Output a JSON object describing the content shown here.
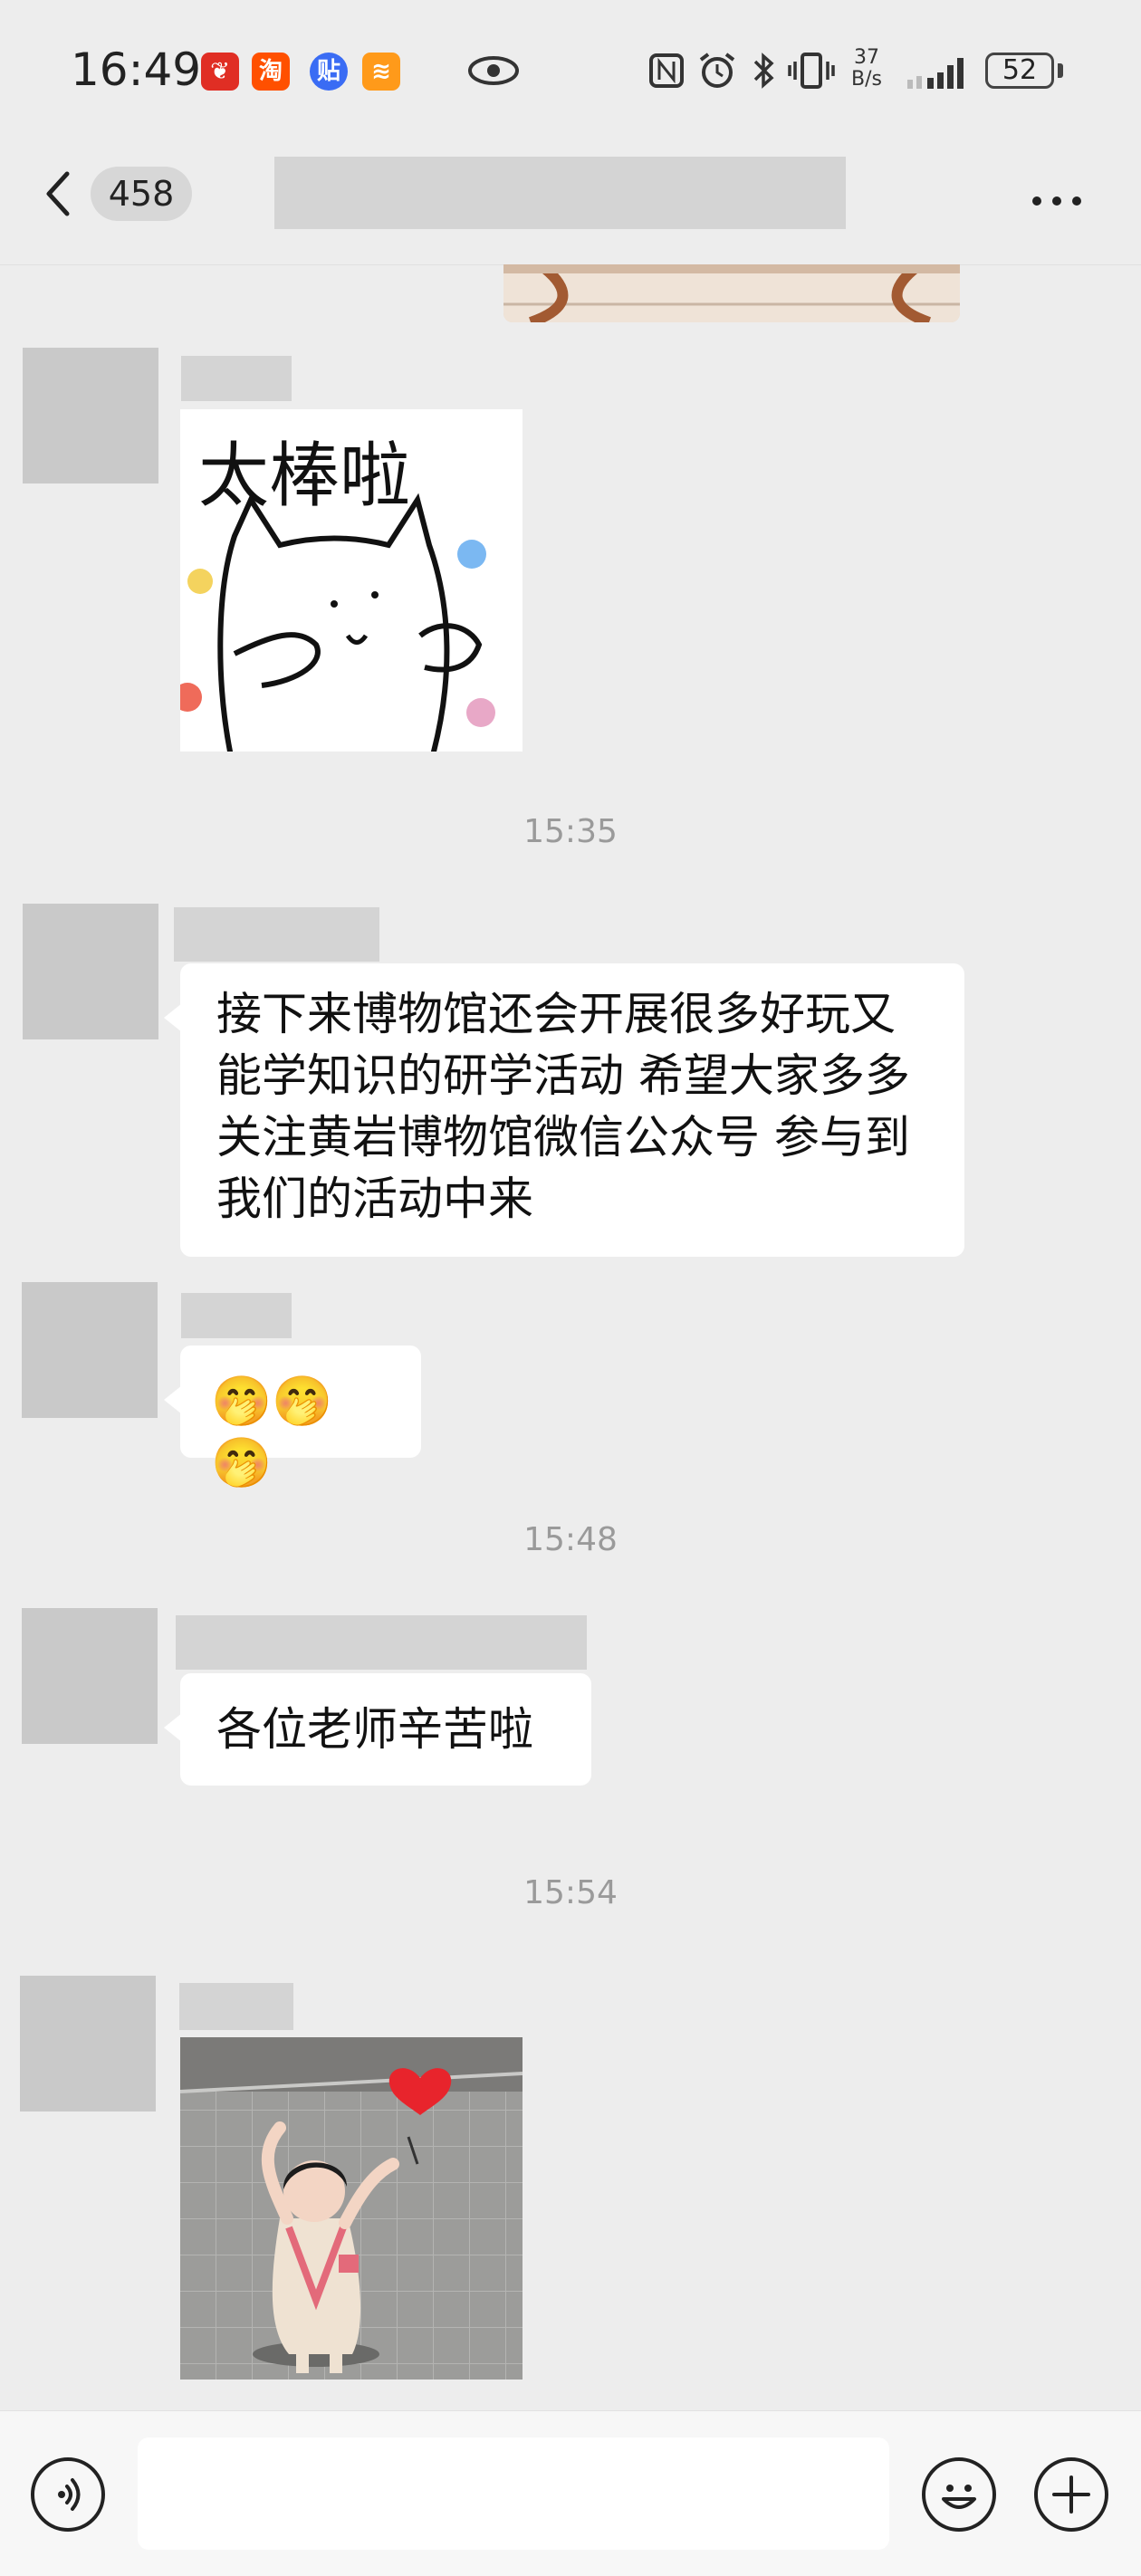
{
  "status_bar": {
    "time": "16:49",
    "app_icons": [
      "pinduoduo-icon",
      "taobao-icon",
      "tieba-icon",
      "app-icon"
    ],
    "net_speed_value": "37",
    "net_speed_unit": "B/s",
    "battery": "52"
  },
  "nav": {
    "unread_count": "458"
  },
  "messages": {
    "m1_time": "15:35",
    "m2_text": "接下来博物馆还会开展很多好玩又能学知识的研学活动 希望大家多多关注黄岩博物馆微信公众号 参与到我们的活动中来",
    "m3_emoji": "🤭🤭🤭",
    "m4_time": "15:48",
    "m4_text": "各位老师辛苦啦",
    "m5_time": "15:54"
  },
  "sticker": {
    "text": "太棒啦"
  },
  "colors": {
    "background": "#ededed",
    "bubble": "#ffffff",
    "placeholder": "#c9c9c9",
    "heart": "#e8242c"
  }
}
